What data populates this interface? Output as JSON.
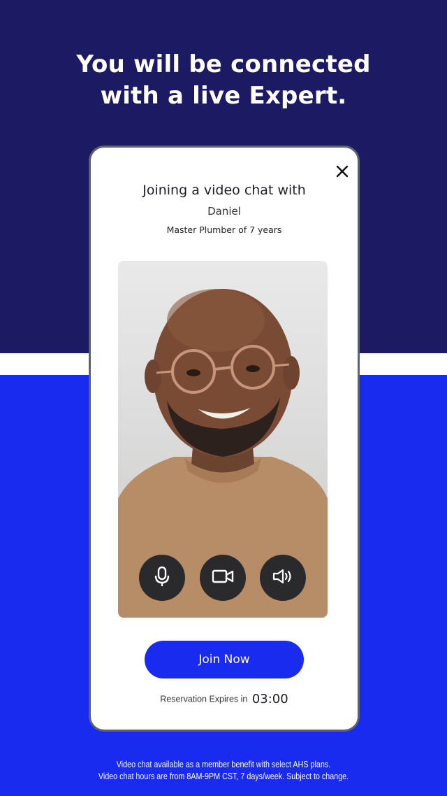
{
  "headline": {
    "line1": "You will be connected",
    "line2": "with a live Expert."
  },
  "dialog": {
    "title": "Joining a video chat with",
    "expert_name": "Daniel",
    "expert_role": "Master Plumber of 7 years",
    "close_icon": "close-icon",
    "controls": [
      {
        "name": "microphone",
        "icon": "microphone-icon"
      },
      {
        "name": "camera",
        "icon": "video-camera-icon"
      },
      {
        "name": "speaker",
        "icon": "speaker-icon"
      }
    ],
    "join_label": "Join Now",
    "expires_label": "Reservation Expires in",
    "expires_time": "03:00"
  },
  "footer": {
    "line1": "Video chat available as a member benefit with select AHS plans.",
    "line2": "Video chat hours are from 8AM-9PM CST, 7 days/week. Subject to change."
  },
  "colors": {
    "navy": "#1b1a62",
    "brand_blue": "#1a2bf0",
    "white": "#ffffff",
    "control_dark": "#2a2a2c"
  }
}
